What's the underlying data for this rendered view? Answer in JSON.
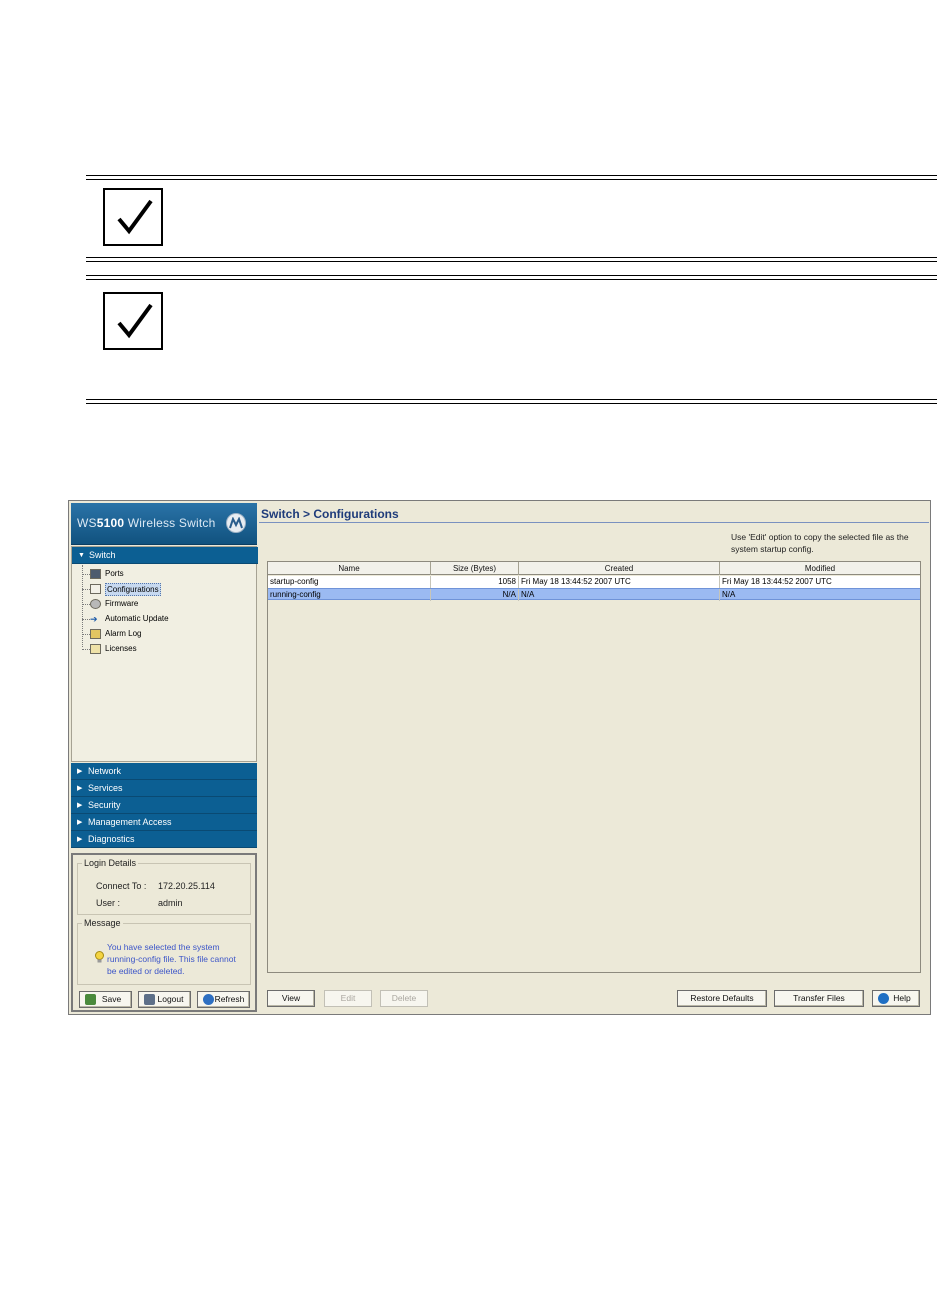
{
  "window": {
    "brand_prefix": "WS",
    "brand_model": "5100",
    "brand_suffix": " Wireless Switch"
  },
  "sidebar": {
    "switch_header": "Switch",
    "tree_items": [
      {
        "label": "Ports",
        "icon": "ports-icon"
      },
      {
        "label": "Configurations",
        "icon": "configurations-icon",
        "selected": true
      },
      {
        "label": "Firmware",
        "icon": "firmware-icon"
      },
      {
        "label": "Automatic Update",
        "icon": "automatic-update-icon"
      },
      {
        "label": "Alarm Log",
        "icon": "alarm-log-icon"
      },
      {
        "label": "Licenses",
        "icon": "licenses-icon"
      }
    ],
    "sections": [
      "Network",
      "Services",
      "Security",
      "Management Access",
      "Diagnostics"
    ]
  },
  "login": {
    "legend": "Login Details",
    "connect_label": "Connect To :",
    "connect_value": "172.20.25.114",
    "user_label": "User :",
    "user_value": "admin",
    "message_legend": "Message",
    "message_text": "You have selected the system running-config file. This file cannot be edited or deleted."
  },
  "sidebar_buttons": {
    "save": "Save",
    "logout": "Logout",
    "refresh": "Refresh"
  },
  "main": {
    "title": "Switch > Configurations",
    "hint": "Use 'Edit' option to copy the selected file as the system startup config.",
    "columns": [
      "Name",
      "Size (Bytes)",
      "Created",
      "Modified"
    ],
    "rows": [
      {
        "name": "startup-config",
        "size": "1058",
        "created": "Fri May 18 13:44:52 2007 UTC",
        "modified": "Fri May 18 13:44:52 2007 UTC"
      },
      {
        "name": "running-config",
        "size": "N/A",
        "created": "N/A",
        "modified": "N/A",
        "selected": true
      }
    ],
    "buttons": {
      "view": "View",
      "edit": "Edit",
      "delete": "Delete",
      "restore": "Restore Defaults",
      "transfer": "Transfer Files",
      "help": "Help"
    }
  },
  "colors": {
    "nav_blue": "#0c5f93",
    "selection_blue": "#9bbaf2",
    "message_blue": "#3c55c8"
  }
}
